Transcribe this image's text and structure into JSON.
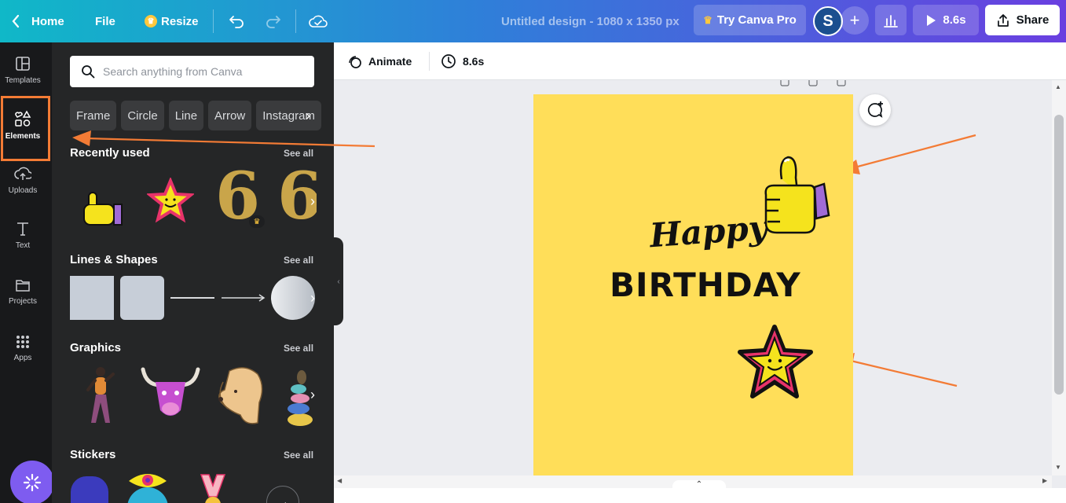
{
  "topbar": {
    "home_label": "Home",
    "file_label": "File",
    "resize_label": "Resize",
    "design_title": "Untitled design - 1080 x 1350 px",
    "pro_label": "Try Canva Pro",
    "avatar_initial": "S",
    "play_duration": "8.6s",
    "share_label": "Share"
  },
  "rail": {
    "items": [
      {
        "label": "Templates",
        "icon": "templates-icon"
      },
      {
        "label": "Elements",
        "icon": "elements-icon",
        "active": true
      },
      {
        "label": "Uploads",
        "icon": "uploads-icon"
      },
      {
        "label": "Text",
        "icon": "text-icon"
      },
      {
        "label": "Projects",
        "icon": "projects-icon"
      },
      {
        "label": "Apps",
        "icon": "apps-icon"
      }
    ]
  },
  "panel": {
    "search_placeholder": "Search anything from Canva",
    "chips": [
      "Frame",
      "Circle",
      "Line",
      "Arrow",
      "Instagram"
    ],
    "sections": [
      {
        "title": "Recently used",
        "see_all": "See all"
      },
      {
        "title": "Lines & Shapes",
        "see_all": "See all"
      },
      {
        "title": "Graphics",
        "see_all": "See all"
      },
      {
        "title": "Stickers",
        "see_all": "See all"
      }
    ]
  },
  "toolbar2": {
    "animate_label": "Animate",
    "duration_label": "8.6s"
  },
  "canvas": {
    "line1": "Happy",
    "line2": "BIRTHDAY",
    "background": "#ffde59"
  },
  "colors": {
    "accent_orange": "#f37b35",
    "panel_bg": "#252627",
    "rail_bg": "#18191b"
  }
}
